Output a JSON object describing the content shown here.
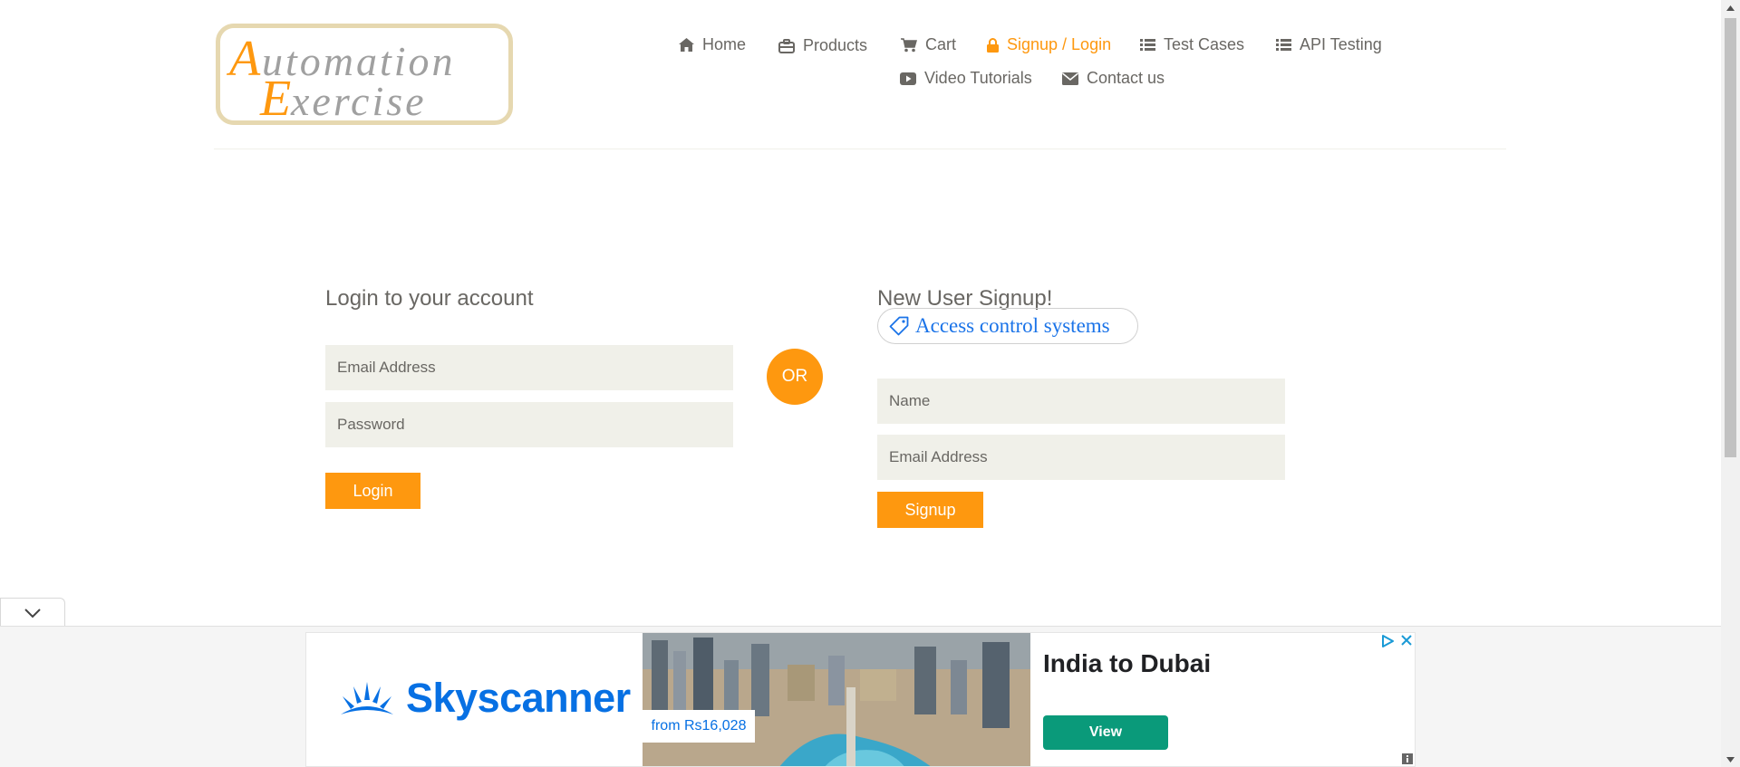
{
  "header": {
    "logo_text": "Automation Exercise",
    "nav": [
      {
        "label": "Home",
        "icon": "home-icon"
      },
      {
        "label": "Products",
        "icon": "briefcase-icon"
      },
      {
        "label": "Cart",
        "icon": "cart-icon"
      },
      {
        "label": "Signup / Login",
        "icon": "lock-icon",
        "active": true
      },
      {
        "label": "Test Cases",
        "icon": "list-icon"
      },
      {
        "label": "API Testing",
        "icon": "list-icon"
      },
      {
        "label": "Video Tutorials",
        "icon": "youtube-play-icon"
      },
      {
        "label": "Contact us",
        "icon": "envelope-icon"
      }
    ]
  },
  "login": {
    "title": "Login to your account",
    "email_placeholder": "Email Address",
    "password_placeholder": "Password",
    "button": "Login"
  },
  "or_label": "OR",
  "signup": {
    "title": "New User Signup!",
    "name_placeholder": "Name",
    "email_placeholder": "Email Address",
    "button": "Signup"
  },
  "inline_ad": {
    "label": "Access control systems",
    "icon": "tag-icon"
  },
  "bottom_ad": {
    "brand": "Skyscanner",
    "price": "from Rs16,028",
    "headline": "India to Dubai",
    "cta": "View"
  },
  "colors": {
    "accent": "#FE980F",
    "field_bg": "#F0F0E9",
    "text": "#696763",
    "ad_link": "#1A73E8",
    "skyscanner_blue": "#0770E3",
    "ad_cta": "#0A9A7A"
  }
}
